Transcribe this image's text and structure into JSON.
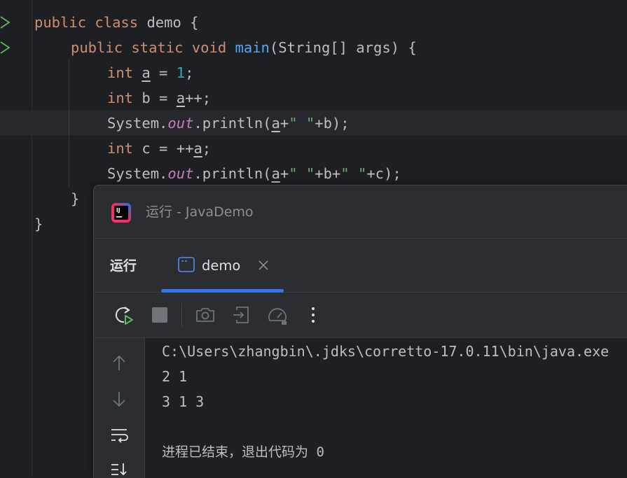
{
  "editor": {
    "line1": {
      "kw": "public class",
      "rest": " demo {"
    },
    "line2": {
      "kw": "public static void",
      "fn": "main",
      "rest": "(String[] args) {"
    },
    "line3": {
      "kw": "int",
      "var": "a",
      "mid": " = ",
      "num": "1",
      "end": ";"
    },
    "line4": {
      "kw": "int",
      "pre": " b = ",
      "var": "a",
      "end": "++;"
    },
    "line5": {
      "pre": "System.",
      "fld": "out",
      "mid": ".println(",
      "var": "a",
      "plus": "+",
      "str": "\" \"",
      "end": "+b);"
    },
    "line6": {
      "kw": "int",
      "pre": " c = ++",
      "var": "a",
      "end": ";"
    },
    "line7": {
      "pre": "System.",
      "fld": "out",
      "mid": ".println(",
      "var": "a",
      "plus": "+",
      "str1": "\" \"",
      "mid2": "+b+",
      "str2": "\" \"",
      "end": "+c);"
    },
    "line8": "}",
    "line9": "}"
  },
  "run_window": {
    "title": "运行 - JavaDemo",
    "tool_label": "运行",
    "tab_label": "demo",
    "console_lines": [
      "C:\\Users\\zhangbin\\.jdks\\corretto-17.0.11\\bin\\java.exe",
      "2 1",
      "3 1 3",
      "",
      "进程已结束，退出代码为 0"
    ]
  },
  "icons": {
    "run_gutter": "run-arrow-icon",
    "rerun": "rerun-icon",
    "stop": "stop-icon",
    "screenshot": "camera-icon",
    "export": "export-icon",
    "profiler": "gauge-icon",
    "more": "more-vertical-icon",
    "up": "arrow-up-icon",
    "down": "arrow-down-icon",
    "soft_wrap": "soft-wrap-icon",
    "scroll_to_end": "scroll-to-end-icon"
  },
  "colors": {
    "keyword": "#cf8e6d",
    "number": "#2aacb8",
    "string": "#6aab73",
    "field": "#c77dbb",
    "method": "#56a8f5",
    "accent": "#3574f0"
  }
}
